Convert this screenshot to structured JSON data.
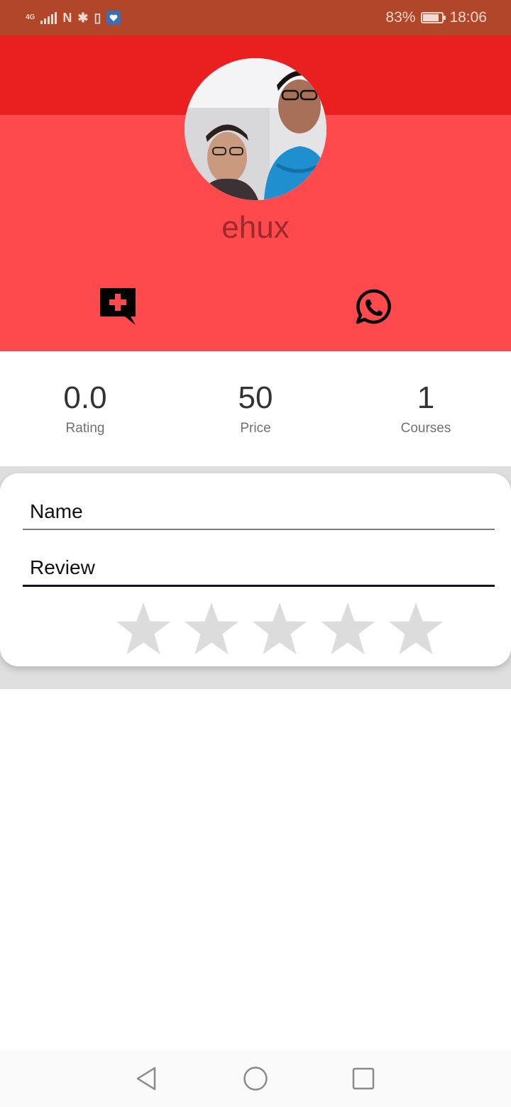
{
  "status_bar": {
    "network": "4G",
    "battery_percent": "83%",
    "battery_level": 0.83,
    "time": "18:06"
  },
  "profile": {
    "username": "ehux",
    "avatar": "profile-photo"
  },
  "actions": {
    "add_comment_icon": "chat-plus-icon",
    "whatsapp_icon": "whatsapp-icon"
  },
  "stats": [
    {
      "value": "0.0",
      "label": "Rating"
    },
    {
      "value": "50",
      "label": "Price"
    },
    {
      "value": "1",
      "label": "Courses"
    }
  ],
  "review_form": {
    "name_label": "Name",
    "review_label": "Review",
    "rating_stars": 5,
    "rating_value": 0,
    "star_color_empty": "#dcdcdc"
  },
  "colors": {
    "status_bar": "#b24628",
    "header_top": "#e91f20",
    "header_main": "#fe4a4c",
    "username": "#9c2a2c"
  },
  "nav_bar": {
    "back_icon": "back-triangle-icon",
    "home_icon": "home-circle-icon",
    "recents_icon": "recents-square-icon"
  }
}
